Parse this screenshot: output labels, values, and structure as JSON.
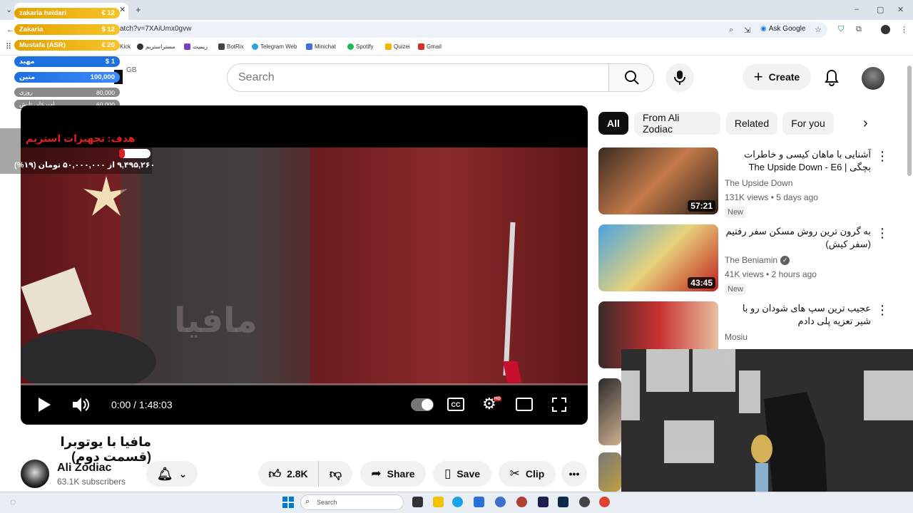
{
  "browser": {
    "url_fragment": "atch?v=7XAiUmx0gvw",
    "ask_google": "Ask Google",
    "bookmarks": [
      "Kick",
      "مسترا‌ستریم",
      "زیمپت",
      "BotRix",
      "Telegram Web",
      "Minichat",
      "Spotify",
      "Quizei",
      "Gmail"
    ]
  },
  "donations": [
    {
      "name": "zakaria heidari",
      "amount": "€ 12"
    },
    {
      "name": "Zakaria",
      "amount": "$ 12"
    },
    {
      "name": "Mustafa (ASR)",
      "amount": "€ 20"
    },
    {
      "name": "مهید",
      "amount": "$ 1"
    },
    {
      "name": "متین",
      "amount": "100,000"
    },
    {
      "name": "روزی",
      "amount": "80,000"
    },
    {
      "name": "امیرعلی تابش",
      "amount": "60,000"
    }
  ],
  "stream_goal": {
    "title": "هدف: تجهیزات استریم",
    "progress_text": "۹,۴۹۵,۲۶۰ از ۵۰,۰۰۰,۰۰۰ تومان (۱۹%)",
    "progress": 0.19
  },
  "header": {
    "logo_suffix": "GB",
    "search_placeholder": "Search",
    "create_label": "Create"
  },
  "chips": [
    "All",
    "From Ali Zodiac",
    "Related",
    "For you"
  ],
  "player": {
    "time": "0:00 / 1:48:03",
    "hd_badge": "HD",
    "watermark": "مافیا"
  },
  "video": {
    "title": "مافیا با یوتوبرا (قسمت دوم)",
    "channel": "Ali Zodiac",
    "subscribers": "63.1K subscribers",
    "likes": "2.8K",
    "share_label": "Share",
    "save_label": "Save",
    "clip_label": "Clip"
  },
  "recommendations": [
    {
      "title": "آشنایی با ماهان کیسی و خاطرات بچگی | The Upside Down - E6",
      "channel": "The Upside Down",
      "meta": "131K views • 5 days ago",
      "badge": "New",
      "duration": "57:21"
    },
    {
      "title": "به گرون ترین روش مسکن سفر رفتیم (سفر کیش)",
      "channel": "The Beniamin",
      "meta": "41K views • 2 hours ago",
      "badge": "New",
      "duration": "43:45"
    },
    {
      "title": "عجیب ترین سپ های شودان رو با شیر تعزیه پلی دادم",
      "channel": "Mosiu",
      "meta": "",
      "badge": "",
      "duration": ""
    }
  ],
  "taskbar": {
    "search_placeholder": "Search"
  },
  "colors": {
    "accent_red": "#ff0000",
    "chip_bg": "#f2f2f2",
    "taskbar_bg": "#e9eef4"
  }
}
